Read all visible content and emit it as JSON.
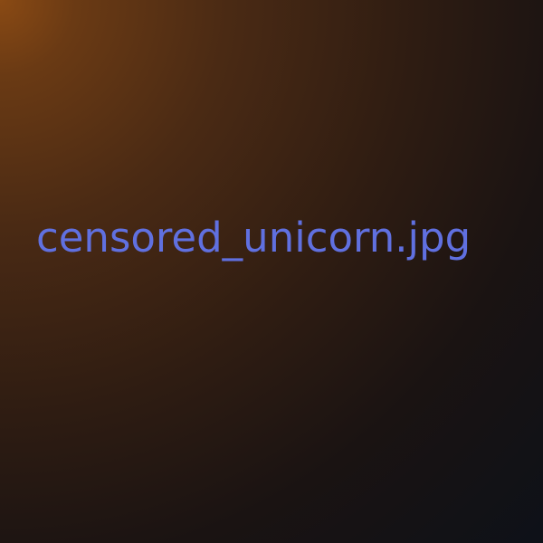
{
  "image": {
    "filename": "censored_unicorn.jpg",
    "text_color": "#6070e0",
    "background_gradient": [
      "#8a4a14",
      "#4a2a14",
      "#1a1312",
      "#0e1118"
    ]
  }
}
